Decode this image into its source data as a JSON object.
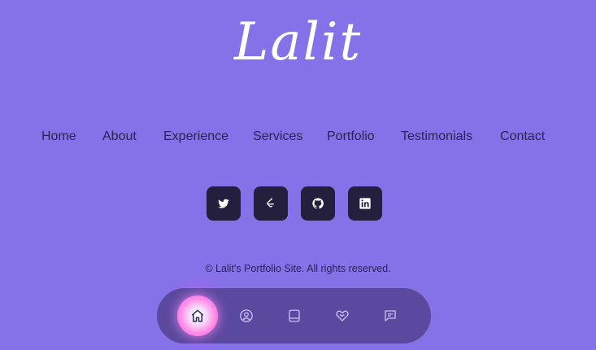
{
  "logo": {
    "text": "Lalit"
  },
  "nav": {
    "items": [
      {
        "label": "Home"
      },
      {
        "label": "About"
      },
      {
        "label": "Experience"
      },
      {
        "label": "Services"
      },
      {
        "label": "Portfolio"
      },
      {
        "label": "Testimonials"
      },
      {
        "label": "Contact"
      }
    ]
  },
  "socials": [
    {
      "icon": "twitter-icon"
    },
    {
      "icon": "leetcode-icon"
    },
    {
      "icon": "github-icon"
    },
    {
      "icon": "linkedin-icon"
    }
  ],
  "footer": {
    "copyright": "© Lalit's Portfolio Site. All rights reserved."
  },
  "dock": {
    "items": [
      {
        "icon": "home-icon",
        "active": true
      },
      {
        "icon": "user-icon",
        "active": false
      },
      {
        "icon": "book-icon",
        "active": false
      },
      {
        "icon": "handshake-icon",
        "active": false
      },
      {
        "icon": "message-icon",
        "active": false
      }
    ]
  },
  "colors": {
    "background": "#8571e8",
    "dock": "#5a499e",
    "social_button": "#231f3d",
    "text": "#2b2450",
    "active_glow": "#ee55f0"
  }
}
